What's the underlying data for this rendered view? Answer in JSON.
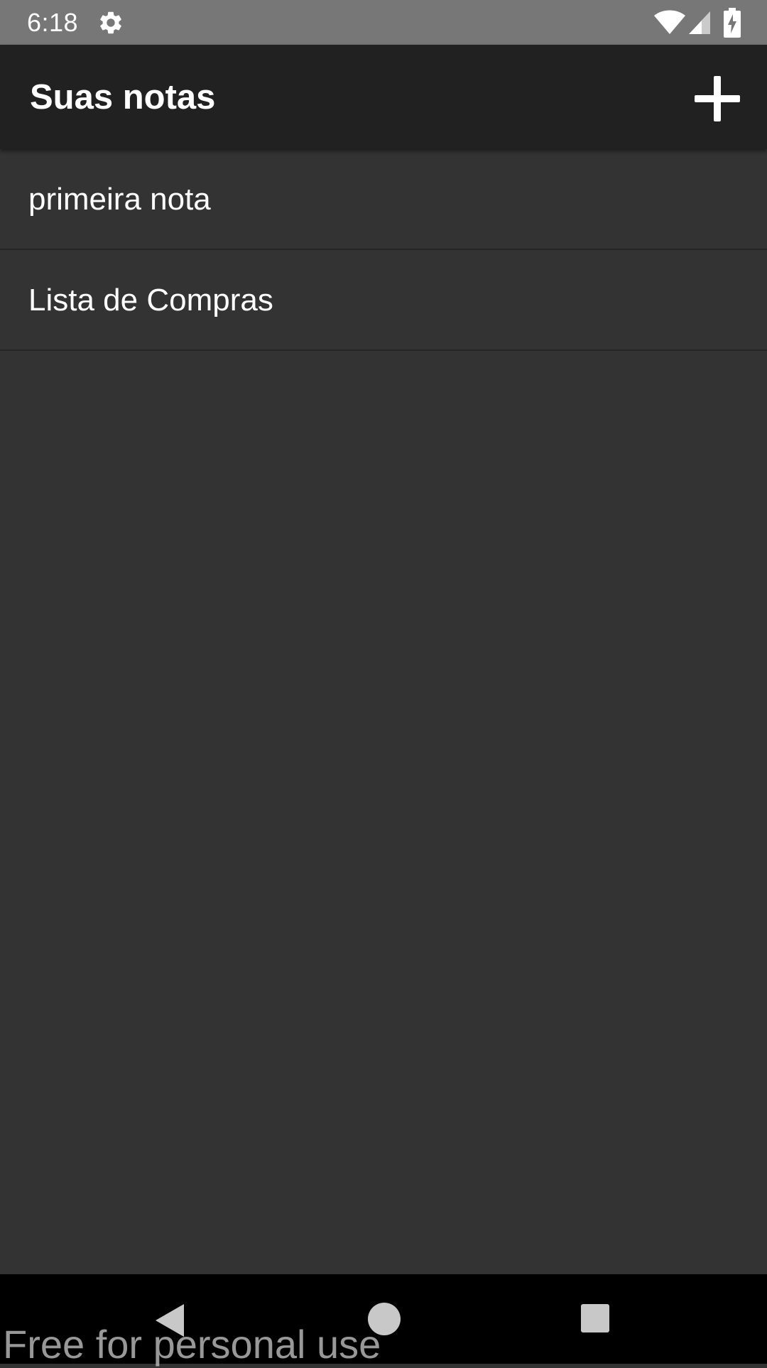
{
  "status_bar": {
    "time": "6:18",
    "icons": [
      "gear-icon",
      "wifi-icon",
      "cell-signal-icon",
      "battery-charging-icon"
    ]
  },
  "app_bar": {
    "title": "Suas notas",
    "add_icon": "plus-icon"
  },
  "notes": [
    {
      "title": "primeira nota"
    },
    {
      "title": "Lista de Compras"
    }
  ],
  "nav_bar": {
    "icons": [
      "back-icon",
      "home-icon",
      "recents-icon"
    ]
  },
  "watermark": "Free for personal use",
  "colors": {
    "status_bar": "#777777",
    "app_bar": "#212121",
    "background": "#333333",
    "divider": "#262626",
    "nav_bar": "#000000",
    "text": "#ffffff"
  }
}
